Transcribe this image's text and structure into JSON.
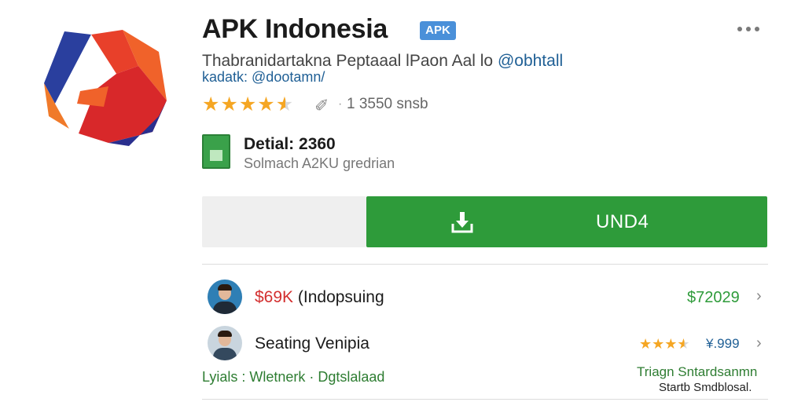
{
  "app": {
    "title": "APK Indonesia",
    "badge": "APK",
    "subtitle": "Thabranidartakna Peptaaal lPaon Aal lo",
    "subtitle_handle": "@obhtall",
    "handle": "kadatk: @dootamn/",
    "rating_stars": 4.5,
    "rating_sep": "·",
    "count": "1 3550 snsb"
  },
  "detail": {
    "title": "Detial:  2360",
    "subtitle": "Solmach A2KU gredrian"
  },
  "install": {
    "label": "UND4"
  },
  "list": [
    {
      "title_red": "$69K",
      "title_rest": " (Indopsuing",
      "value": "$72029"
    },
    {
      "title": "Seating Venipia",
      "stars": 3.5,
      "value": "¥.999"
    }
  ],
  "tags": "Lyials : Wletnerk  ·  Dgtslalaad",
  "footer_right": {
    "line1": "Triagn Sntardsanmn",
    "line2": "Startb Smdblosal."
  },
  "colors": {
    "install_green": "#2e9b3a",
    "badge_blue": "#4a90d9",
    "star_orange": "#f5a623",
    "price_red": "#d32f2f"
  },
  "icons": {
    "more": "more-icon",
    "download": "download-icon",
    "pin": "pin-icon",
    "chevron": "chevron-right-icon"
  }
}
